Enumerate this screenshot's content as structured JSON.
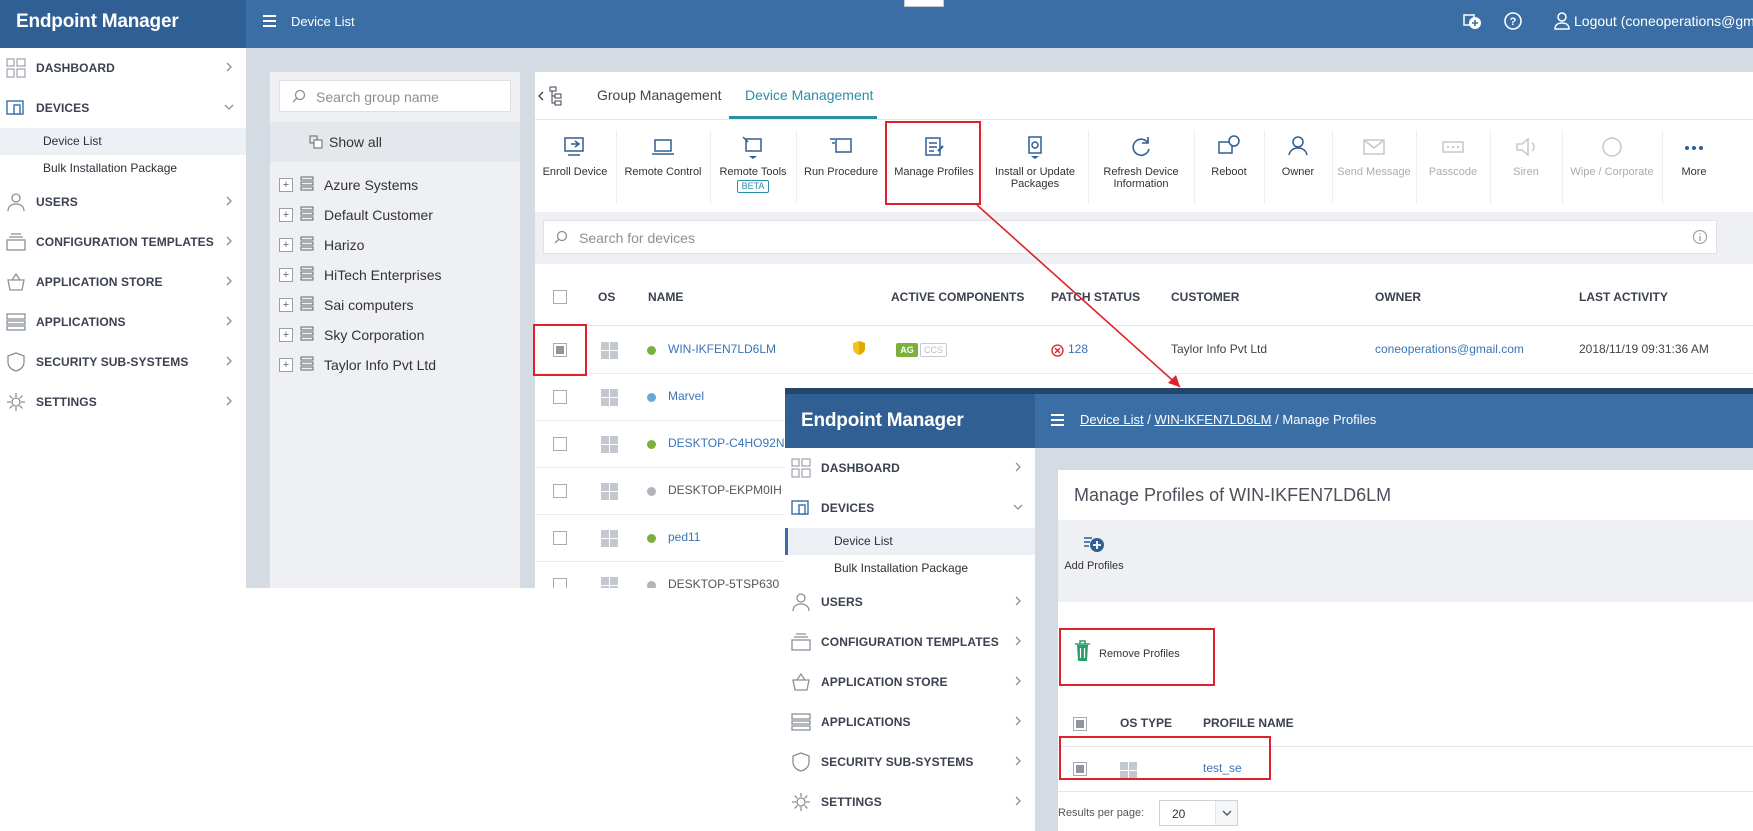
{
  "main": {
    "brand": "Endpoint Manager",
    "breadcrumb": "Device List",
    "logout": "Logout (coneoperations@gm",
    "sidebar": {
      "dashboard": "DASHBOARD",
      "devices": "DEVICES",
      "device_list": "Device List",
      "bulk": "Bulk Installation Package",
      "users": "USERS",
      "config": "CONFIGURATION TEMPLATES",
      "appstore": "APPLICATION STORE",
      "applications": "APPLICATIONS",
      "security": "SECURITY SUB-SYSTEMS",
      "settings": "SETTINGS"
    },
    "groups": {
      "search_placeholder": "Search group name",
      "show_all": "Show all",
      "items": [
        "Azure Systems",
        "Default Customer",
        "Harizo",
        "HiTech Enterprises",
        "Sai computers",
        "Sky Corporation",
        "Taylor Info Pvt Ltd"
      ]
    },
    "tabs": {
      "group": "Group Management",
      "device": "Device Management"
    },
    "toolbar": {
      "enroll": "Enroll Device",
      "remote_control": "Remote Control",
      "remote_tools": "Remote Tools",
      "beta": "BETA",
      "run_procedure": "Run Procedure",
      "manage_profiles": "Manage Profiles",
      "install_1": "Install or Update",
      "install_2": "Packages",
      "refresh_1": "Refresh Device",
      "refresh_2": "Information",
      "reboot": "Reboot",
      "owner": "Owner",
      "send_message": "Send Message",
      "passcode": "Passcode",
      "siren": "Siren",
      "wipe": "Wipe / Corporate",
      "more": "More"
    },
    "search_placeholder": "Search for devices",
    "columns": {
      "os": "OS",
      "name": "NAME",
      "active": "ACTIVE COMPONENTS",
      "patch": "PATCH STATUS",
      "customer": "CUSTOMER",
      "owner": "OWNER",
      "last": "LAST ACTIVITY"
    },
    "rows": [
      {
        "name": "WIN-IKFEN7LD6LM",
        "status": "green",
        "badge1": "AG",
        "badge2": "CCS",
        "patch": "128",
        "customer": "Taylor Info Pvt Ltd",
        "owner": "coneoperations@gmail.com",
        "last": "2018/11/19 09:31:36 AM"
      },
      {
        "name": "Marvel",
        "status": "blue"
      },
      {
        "name": "DESKTOP-C4HO92N",
        "status": "green"
      },
      {
        "name": "DESKTOP-EKPM0IH",
        "status": "gray"
      },
      {
        "name": "ped11",
        "status": "green"
      },
      {
        "name": "DESKTOP-5TSP630",
        "status": "gray"
      }
    ]
  },
  "overlay": {
    "brand": "Endpoint Manager",
    "crumb_1": "Device List",
    "crumb_sep": "/",
    "crumb_2": "WIN-IKFEN7LD6LM",
    "crumb_3": "Manage Profiles",
    "title": "Manage Profiles of WIN-IKFEN7LD6LM",
    "add_profiles": "Add Profiles",
    "remove_profiles": "Remove Profiles",
    "col_os": "OS TYPE",
    "col_profile": "PROFILE NAME",
    "profile_row": "test_se",
    "results_label": "Results per page:",
    "results_value": "20"
  },
  "colors": {
    "header": "#3a6ea5",
    "brand_bg": "#2f5f93",
    "accent": "#2b8fa6",
    "highlight": "#e0202a",
    "link": "#3a74b8"
  }
}
